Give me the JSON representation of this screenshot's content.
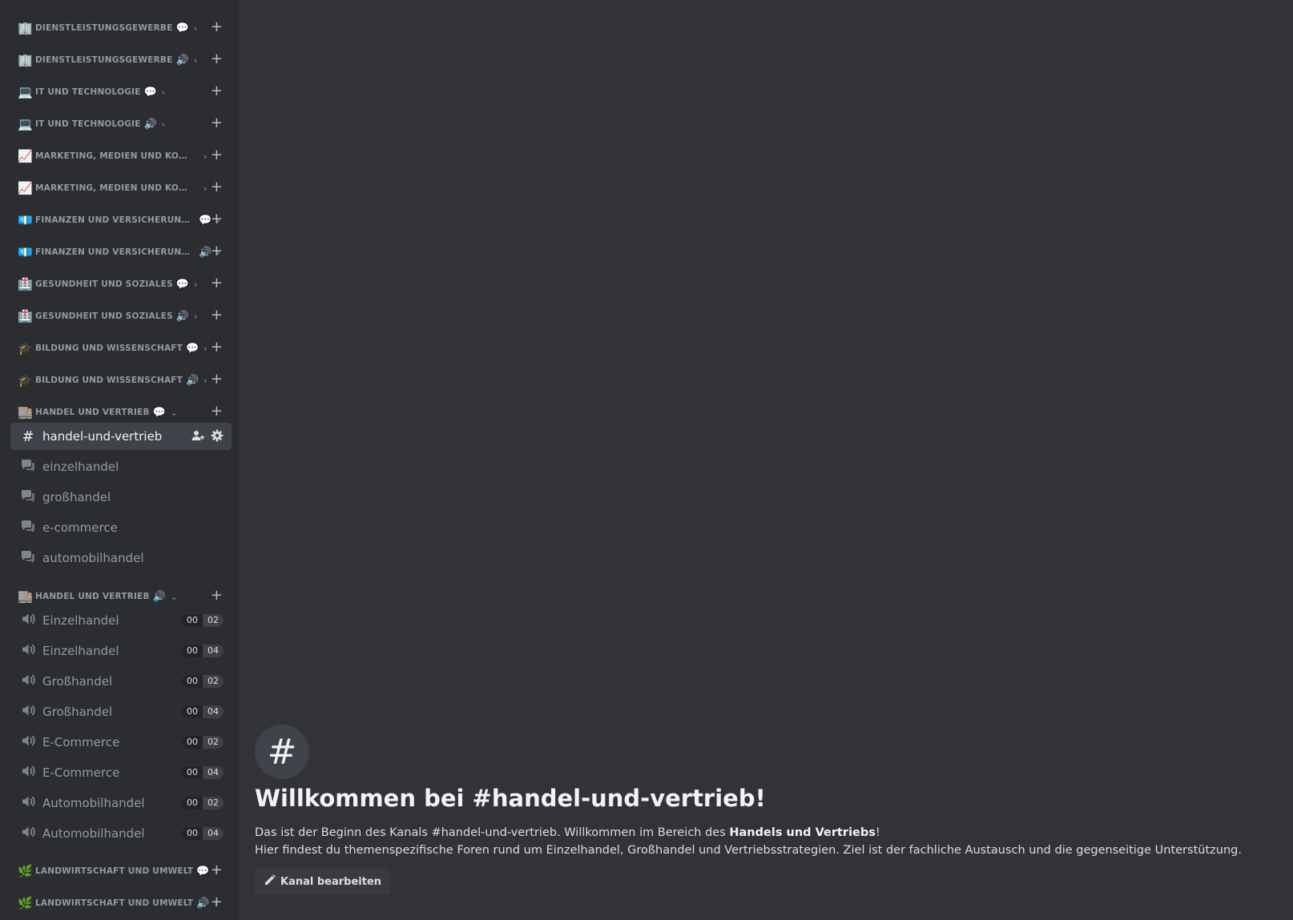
{
  "categories": [
    {
      "emoji": "🏢",
      "label": "Dienstleistungsgewerbe",
      "suffix": "💬",
      "chevron": "›"
    },
    {
      "emoji": "🏢",
      "label": "Dienstleistungsgewerbe",
      "suffix": "🔊",
      "chevron": "›"
    },
    {
      "emoji": "💻",
      "label": "IT und Technologie",
      "suffix": "💬",
      "chevron": "›"
    },
    {
      "emoji": "💻",
      "label": "IT und Technologie",
      "suffix": "🔊",
      "chevron": "›"
    },
    {
      "emoji": "📈",
      "label": "Marketing, Medien und Kommuni...",
      "suffix": "",
      "chevron": "›"
    },
    {
      "emoji": "📈",
      "label": "Marketing, Medien und Kommuni...",
      "suffix": "",
      "chevron": "›"
    },
    {
      "emoji": "💶",
      "label": "Finanzen und Versicherungen",
      "suffix": "💬",
      "chevron": "›"
    },
    {
      "emoji": "💶",
      "label": "Finanzen und Versicherungen",
      "suffix": "🔊",
      "chevron": "›"
    },
    {
      "emoji": "🏥",
      "label": "Gesundheit und Soziales",
      "suffix": "💬",
      "chevron": "›"
    },
    {
      "emoji": "🏥",
      "label": "Gesundheit und Soziales",
      "suffix": "🔊",
      "chevron": "›"
    },
    {
      "emoji": "🎓",
      "label": "Bildung und Wissenschaft",
      "suffix": "💬",
      "chevron": "›"
    },
    {
      "emoji": "🎓",
      "label": "Bildung und Wissenschaft",
      "suffix": "🔊",
      "chevron": "›"
    },
    {
      "emoji": "🏬",
      "label": "Handel und Vertrieb",
      "suffix": "💬",
      "chevron": "⌄"
    },
    {
      "emoji": "🏬",
      "label": "Handel und Vertrieb",
      "suffix": "🔊",
      "chevron": "⌄"
    },
    {
      "emoji": "🌿",
      "label": "Landwirtschaft und Umwelt",
      "suffix": "💬",
      "chevron": "›"
    },
    {
      "emoji": "🌿",
      "label": "Landwirtschaft und Umwelt",
      "suffix": "🔊",
      "chevron": "›"
    }
  ],
  "plus_glyph": "+",
  "text_channel": {
    "hash": "#",
    "name": "handel-und-vertrieb"
  },
  "forum_channels": [
    {
      "name": "einzelhandel"
    },
    {
      "name": "großhandel"
    },
    {
      "name": "e-commerce"
    },
    {
      "name": "automobilhandel"
    }
  ],
  "voice_channels": [
    {
      "name": "Einzelhandel",
      "count": "00",
      "limit": "02"
    },
    {
      "name": "Einzelhandel",
      "count": "00",
      "limit": "04"
    },
    {
      "name": "Großhandel",
      "count": "00",
      "limit": "02"
    },
    {
      "name": "Großhandel",
      "count": "00",
      "limit": "04"
    },
    {
      "name": "E-Commerce",
      "count": "00",
      "limit": "02"
    },
    {
      "name": "E-Commerce",
      "count": "00",
      "limit": "04"
    },
    {
      "name": "Automobilhandel",
      "count": "00",
      "limit": "02"
    },
    {
      "name": "Automobilhandel",
      "count": "00",
      "limit": "04"
    }
  ],
  "welcome": {
    "icon": "#",
    "title": "Willkommen bei #handel-und-vertrieb!",
    "line1_prefix": "Das ist der Beginn des Kanals #handel-und-vertrieb. Willkommen im Bereich des ",
    "line1_bold": "Handels und Vertriebs",
    "line1_suffix": "!",
    "line2": "Hier findest du themenspezifische Foren rund um Einzelhandel, Großhandel und Vertriebsstrategien. Ziel ist der fachliche Austausch und die gegenseitige Unterstützung.",
    "edit_button": "Kanal bearbeiten"
  },
  "colors": {
    "sidebar": "#2b2d31",
    "main": "#313338",
    "selected": "#404249"
  }
}
